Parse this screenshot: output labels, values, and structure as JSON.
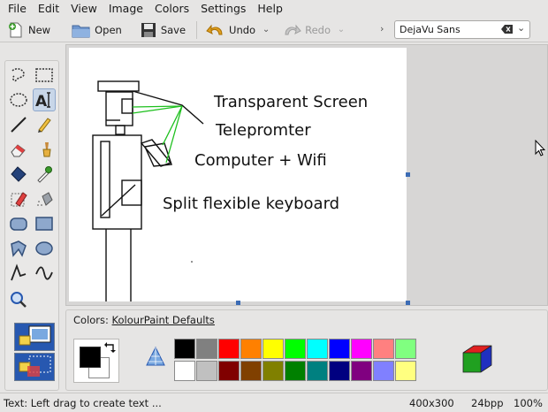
{
  "menu": [
    "File",
    "Edit",
    "View",
    "Image",
    "Colors",
    "Settings",
    "Help"
  ],
  "toolbar": {
    "new_label": "New",
    "open_label": "Open",
    "save_label": "Save",
    "undo_label": "Undo",
    "redo_label": "Redo",
    "font_value": "DejaVu Sans"
  },
  "canvas": {
    "texts": [
      "Transparent Screen",
      "Telepromter",
      "Computer + Wifi",
      "Split flexible keyboard"
    ]
  },
  "colors": {
    "title_prefix": "Colors:",
    "title_name": "KolourPaint Defaults",
    "palette_top": [
      "#000000",
      "#808080",
      "#ff0000",
      "#ff8000",
      "#ffff00",
      "#00ff00",
      "#00ffff",
      "#0000ff",
      "#ff00ff",
      "#ff8080",
      "#80ff80"
    ],
    "palette_bottom": [
      "#ffffff",
      "#c0c0c0",
      "#800000",
      "#804000",
      "#808000",
      "#008000",
      "#008080",
      "#000080",
      "#800080",
      "#8080ff",
      "#ffff80"
    ],
    "foreground": "#000000",
    "background": "#ffffff"
  },
  "status": {
    "text": "Text: Left drag to create text ...",
    "size": "400x300",
    "depth": "24bpp",
    "zoom": "100%"
  }
}
